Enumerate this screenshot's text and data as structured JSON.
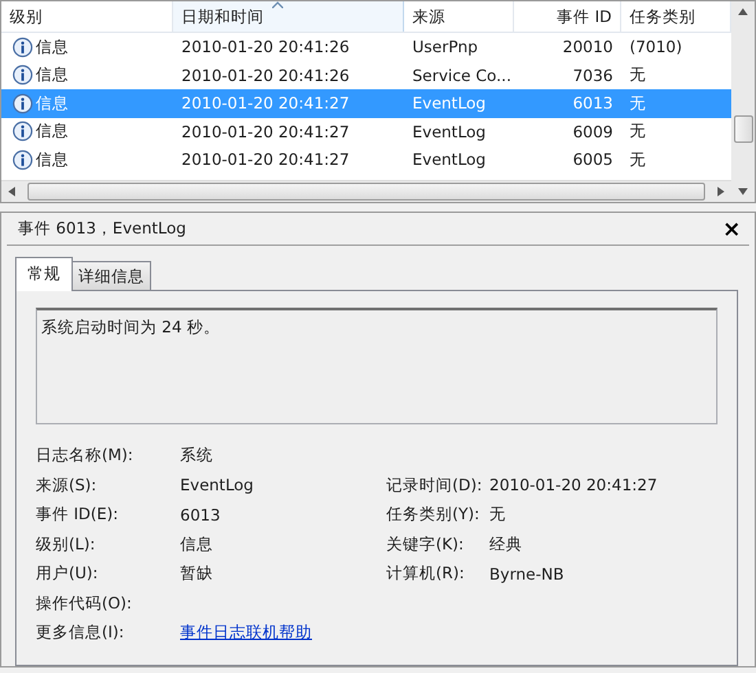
{
  "event_list": {
    "columns": [
      {
        "label": "级别",
        "sorted": false
      },
      {
        "label": "日期和时间",
        "sorted": true
      },
      {
        "label": "来源",
        "sorted": false
      },
      {
        "label": "事件 ID",
        "sorted": false
      },
      {
        "label": "任务类别",
        "sorted": false
      }
    ],
    "rows": [
      {
        "level": "信息",
        "date_time": "2010-01-20 20:41:26",
        "source": "UserPnp",
        "event_id": "20010",
        "task_category": "(7010)",
        "selected": false
      },
      {
        "level": "信息",
        "date_time": "2010-01-20 20:41:26",
        "source": "Service Co...",
        "event_id": "7036",
        "task_category": "无",
        "selected": false
      },
      {
        "level": "信息",
        "date_time": "2010-01-20 20:41:27",
        "source": "EventLog",
        "event_id": "6013",
        "task_category": "无",
        "selected": true
      },
      {
        "level": "信息",
        "date_time": "2010-01-20 20:41:27",
        "source": "EventLog",
        "event_id": "6009",
        "task_category": "无",
        "selected": false
      },
      {
        "level": "信息",
        "date_time": "2010-01-20 20:41:27",
        "source": "EventLog",
        "event_id": "6005",
        "task_category": "无",
        "selected": false
      }
    ]
  },
  "detail": {
    "title": "事件 6013，EventLog",
    "close": "×",
    "tabs": [
      {
        "label": "常规",
        "selected": true
      },
      {
        "label": "详细信息",
        "selected": false
      }
    ],
    "message": "系统启动时间为 24 秒。",
    "field_rows": [
      {
        "cells": [
          {
            "label": "日志名称(M):",
            "value": "系统"
          }
        ]
      },
      {
        "cells": [
          {
            "label": "来源(S):",
            "value": "EventLog"
          },
          {
            "label": "记录时间(D):",
            "value": "2010-01-20 20:41:27"
          }
        ]
      },
      {
        "cells": [
          {
            "label": "事件 ID(E):",
            "value": "6013"
          },
          {
            "label": "任务类别(Y):",
            "value": "无"
          }
        ]
      },
      {
        "cells": [
          {
            "label": "级别(L):",
            "value": "信息"
          },
          {
            "label": "关键字(K):",
            "value": "经典"
          }
        ]
      },
      {
        "cells": [
          {
            "label": "用户(U):",
            "value": "暂缺"
          },
          {
            "label": "计算机(R):",
            "value": "Byrne-NB"
          }
        ]
      },
      {
        "cells": [
          {
            "label": "操作代码(O):"
          }
        ]
      },
      {
        "cells": [
          {
            "label": "更多信息(I):",
            "value": "事件日志联机帮助",
            "kind": "link"
          }
        ]
      }
    ]
  }
}
